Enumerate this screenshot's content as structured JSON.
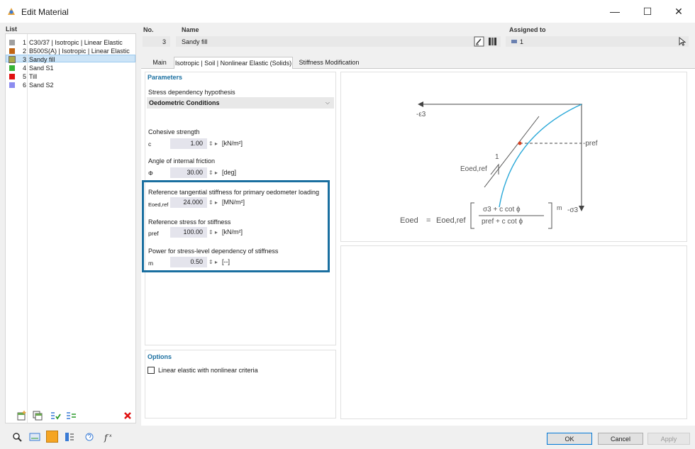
{
  "window": {
    "title": "Edit Material",
    "minimize": "—",
    "maximize": "☐",
    "close": "✕"
  },
  "list": {
    "header": "List",
    "items": [
      {
        "num": "1",
        "label": "C30/37 | Isotropic | Linear Elastic",
        "color": "#a0a0a0"
      },
      {
        "num": "2",
        "label": "B500S(A) | Isotropic | Linear Elastic",
        "color": "#c06414"
      },
      {
        "num": "3",
        "label": "Sandy fill",
        "color": "#a8a848"
      },
      {
        "num": "4",
        "label": "Sand S1",
        "color": "#36b436"
      },
      {
        "num": "5",
        "label": "Till",
        "color": "#e01010"
      },
      {
        "num": "6",
        "label": "Sand S2",
        "color": "#8c8cf0"
      }
    ],
    "selected_index": 2
  },
  "header": {
    "no_label": "No.",
    "no_value": "3",
    "name_label": "Name",
    "name_value": "Sandy fill",
    "assigned_label": "Assigned to",
    "assigned_value": "1"
  },
  "tabs": [
    "Main",
    "Isotropic | Soil | Nonlinear Elastic (Solids)",
    "Stiffness Modification"
  ],
  "parameters": {
    "title": "Parameters",
    "hypothesis_label": "Stress dependency hypothesis",
    "hypothesis_value": "Oedometric Conditions",
    "cohesive_label": "Cohesive strength",
    "c_sym": "c",
    "c_value": "1.00",
    "c_unit": "[kN/m²]",
    "friction_label": "Angle of internal friction",
    "phi_sym": "Φ",
    "phi_value": "30.00",
    "phi_unit": "[deg]",
    "eoed_label": "Reference tangential stiffness for primary oedometer loading",
    "eoed_sym": "Eoed,ref",
    "eoed_value": "24.000",
    "eoed_unit": "[MN/m²]",
    "pref_label": "Reference stress for stiffness",
    "pref_sym": "pref",
    "pref_value": "100.00",
    "pref_unit": "[kN/m²]",
    "m_label": "Power for stress-level dependency of stiffness",
    "m_sym": "m",
    "m_value": "0.50",
    "m_unit": "[--]"
  },
  "options": {
    "title": "Options",
    "linear_elastic_label": "Linear elastic with nonlinear criteria"
  },
  "diagram": {
    "eps_label": "-ε3",
    "sigma_label": "-σ3",
    "pref_label": "-pref",
    "eoed_ref_label": "Eoed,ref",
    "one_label": "1",
    "formula_lhs": "Eoed",
    "formula_eq": "=",
    "formula_ref": "Eoed,ref",
    "formula_num": "σ3 + c cot ϕ",
    "formula_den": "pref + c cot ϕ",
    "formula_exp": "m"
  },
  "buttons": {
    "ok": "OK",
    "cancel": "Cancel",
    "apply": "Apply"
  },
  "colors": {
    "accent": "#1a6fa0",
    "highlight_border": "#1a6fa0",
    "curve": "#29a8d8",
    "tangent": "#4a4a4a",
    "point": "#d94020"
  }
}
